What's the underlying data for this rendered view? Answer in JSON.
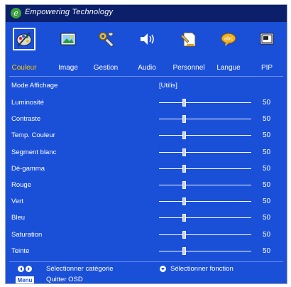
{
  "header": {
    "logo_letter": "e",
    "brand": "Empowering Technology"
  },
  "categories": [
    {
      "icon": "palette-icon",
      "label": "Couleur",
      "selected": true
    },
    {
      "icon": "image-icon",
      "label": "Image",
      "selected": false
    },
    {
      "icon": "tools-icon",
      "label": "Gestion",
      "selected": false
    },
    {
      "icon": "speaker-icon",
      "label": "Audio",
      "selected": false
    },
    {
      "icon": "personal-icon",
      "label": "Personnel",
      "selected": false
    },
    {
      "icon": "language-icon",
      "label": "Langue",
      "selected": false
    },
    {
      "icon": "pip-icon",
      "label": "PIP",
      "selected": false
    }
  ],
  "settings": {
    "mode": {
      "label": "Mode Affichage",
      "value": "[Utilis]"
    },
    "sliders": [
      {
        "label": "Luminosité",
        "value": "50"
      },
      {
        "label": "Contraste",
        "value": "50"
      },
      {
        "label": "Temp. Couleur",
        "value": "50"
      },
      {
        "label": "Segment blanc",
        "value": "50"
      },
      {
        "label": "Dé-gamma",
        "value": "50"
      },
      {
        "label": "Rouge",
        "value": "50"
      },
      {
        "label": "Vert",
        "value": "50"
      },
      {
        "label": "Bleu",
        "value": "50"
      },
      {
        "label": "Saturation",
        "value": "50"
      },
      {
        "label": "Teinte",
        "value": "50"
      }
    ]
  },
  "footer": {
    "select_category": "Sélectionner catégorie",
    "select_function": "Sélectionner fonction",
    "menu_label": "Menu",
    "quit": "Quitter OSD"
  },
  "colors": {
    "panel": "#1a4fd8",
    "topbar": "#0b1f6b",
    "selected_tab": "#ffc400",
    "text": "#ffffff"
  }
}
